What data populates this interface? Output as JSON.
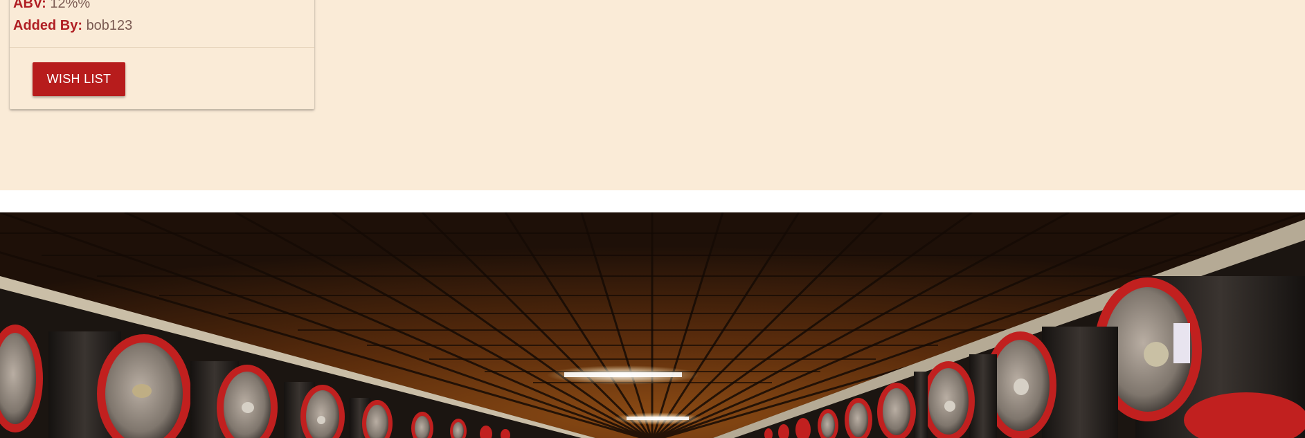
{
  "card": {
    "abv_label": "ABV:",
    "abv_value": "12%%",
    "added_by_label": "Added By:",
    "added_by_value": "bob123",
    "wish_list_label": "WISH LIST"
  },
  "hero_image": {
    "subject": "wine cellar with barrels"
  },
  "colors": {
    "page_background": "#faebd7",
    "accent": "#b71c1c",
    "label_text": "#b01e23"
  }
}
